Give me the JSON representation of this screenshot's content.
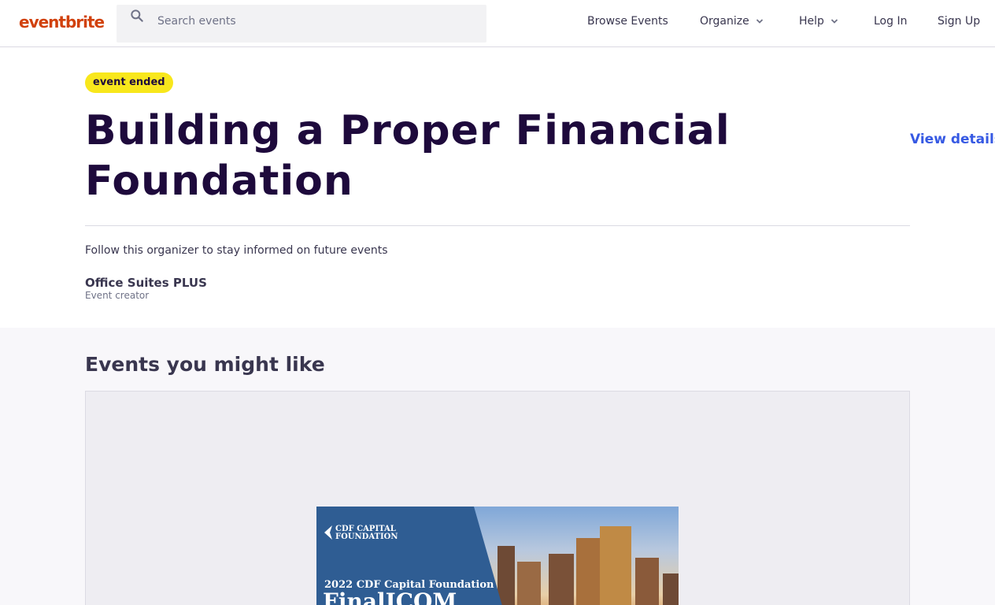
{
  "header": {
    "logo": "eventbrite",
    "search_placeholder": "Search events",
    "nav": {
      "browse": "Browse Events",
      "organize": "Organize",
      "help": "Help",
      "login": "Log In",
      "signup": "Sign Up"
    }
  },
  "event": {
    "status_badge": "event ended",
    "title": "Building a Proper Financial Foundation",
    "view_details": "View details",
    "follow_text": "Follow this organizer to stay informed on future events",
    "organizer_name": "Office Suites PLUS",
    "organizer_role": "Event creator"
  },
  "recommendations": {
    "title": "Events you might like",
    "card": {
      "image_brand_line1": "CDF CAPITAL",
      "image_brand_line2": "FOUNDATION",
      "image_title_line1": "2022 CDF Capital Foundation",
      "image_title_line2": "FinalICOM"
    }
  },
  "colors": {
    "brand": "#d1410c",
    "title": "#1e0a3c",
    "link": "#3659e3",
    "badge": "#f8e71c"
  }
}
